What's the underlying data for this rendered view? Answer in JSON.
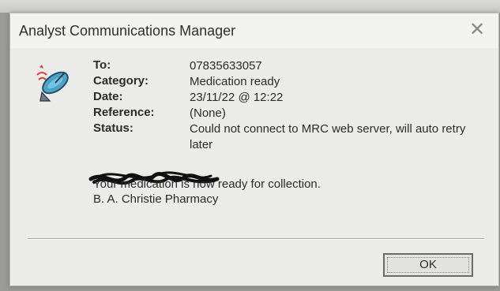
{
  "window": {
    "title": "Analyst Communications Manager",
    "close_glyph": "✕"
  },
  "icon": "satellite-dish-icon",
  "fields": {
    "to": {
      "label": "To:",
      "value": "07835633057"
    },
    "category": {
      "label": "Category:",
      "value": "Medication ready"
    },
    "date": {
      "label": "Date:",
      "value": "23/11/22 @ 12:22"
    },
    "reference": {
      "label": "Reference:",
      "value": "(None)"
    },
    "status": {
      "label": "Status:",
      "value": "Could not connect to MRC web server, will auto retry later"
    }
  },
  "message": {
    "line1": "Your medication is now ready for collection.",
    "line2": "B. A. Christie Pharmacy"
  },
  "buttons": {
    "ok": "OK"
  }
}
